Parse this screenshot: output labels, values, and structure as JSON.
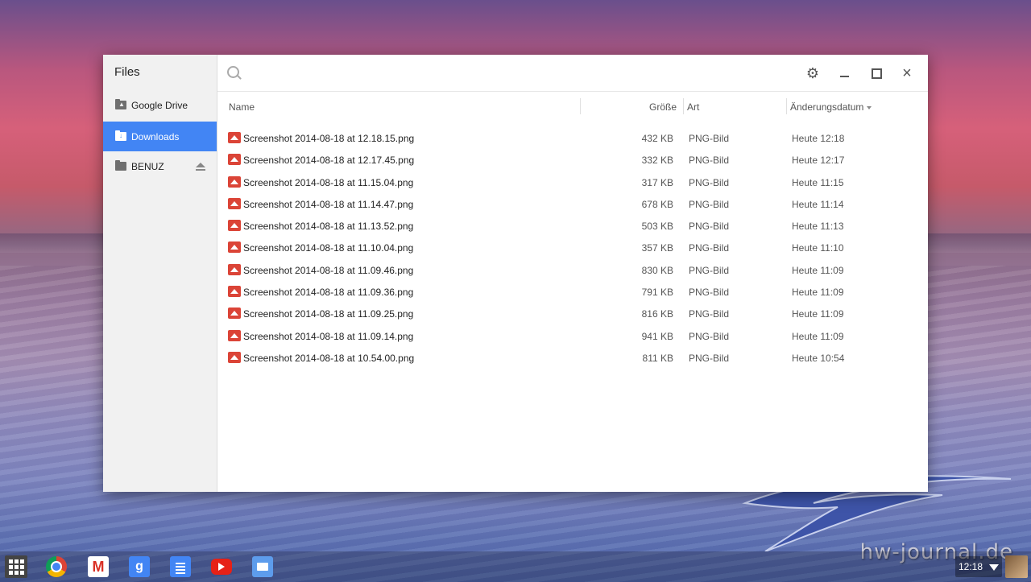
{
  "window": {
    "app_title": "Files"
  },
  "sidebar": {
    "items": [
      {
        "label": "Google Drive",
        "icon": "drive-folder-icon",
        "active": false
      },
      {
        "label": "Downloads",
        "icon": "download-folder-icon",
        "active": true
      },
      {
        "label": "BENUZ",
        "icon": "usb-drive-icon",
        "active": false
      }
    ]
  },
  "toolbar": {
    "search_placeholder": ""
  },
  "columns": {
    "name": "Name",
    "size": "Größe",
    "type": "Art",
    "date": "Änderungsdatum"
  },
  "files": [
    {
      "name": "Screenshot 2014-08-18 at 12.18.15.png",
      "size": "432 KB",
      "type": "PNG-Bild",
      "date": "Heute 12:18"
    },
    {
      "name": "Screenshot 2014-08-18 at 12.17.45.png",
      "size": "332 KB",
      "type": "PNG-Bild",
      "date": "Heute 12:17"
    },
    {
      "name": "Screenshot 2014-08-18 at 11.15.04.png",
      "size": "317 KB",
      "type": "PNG-Bild",
      "date": "Heute 11:15"
    },
    {
      "name": "Screenshot 2014-08-18 at 11.14.47.png",
      "size": "678 KB",
      "type": "PNG-Bild",
      "date": "Heute 11:14"
    },
    {
      "name": "Screenshot 2014-08-18 at 11.13.52.png",
      "size": "503 KB",
      "type": "PNG-Bild",
      "date": "Heute 11:13"
    },
    {
      "name": "Screenshot 2014-08-18 at 11.10.04.png",
      "size": "357 KB",
      "type": "PNG-Bild",
      "date": "Heute 11:10"
    },
    {
      "name": "Screenshot 2014-08-18 at 11.09.46.png",
      "size": "830 KB",
      "type": "PNG-Bild",
      "date": "Heute 11:09"
    },
    {
      "name": "Screenshot 2014-08-18 at 11.09.36.png",
      "size": "791 KB",
      "type": "PNG-Bild",
      "date": "Heute 11:09"
    },
    {
      "name": "Screenshot 2014-08-18 at 11.09.25.png",
      "size": "816 KB",
      "type": "PNG-Bild",
      "date": "Heute 11:09"
    },
    {
      "name": "Screenshot 2014-08-18 at 11.09.14.png",
      "size": "941 KB",
      "type": "PNG-Bild",
      "date": "Heute 11:09"
    },
    {
      "name": "Screenshot 2014-08-18 at 10.54.00.png",
      "size": "811 KB",
      "type": "PNG-Bild",
      "date": "Heute 10:54"
    }
  ],
  "shelf": {
    "apps": [
      "launcher-icon",
      "chrome-icon",
      "gmail-icon",
      "google-search-icon",
      "docs-icon",
      "youtube-icon",
      "files-icon"
    ],
    "gmail_glyph": "M",
    "gsearch_glyph": "g",
    "time": "12:18"
  },
  "watermark": "hw-journal.de",
  "colors": {
    "accent": "#4285f4",
    "file_icon": "#db4437"
  }
}
